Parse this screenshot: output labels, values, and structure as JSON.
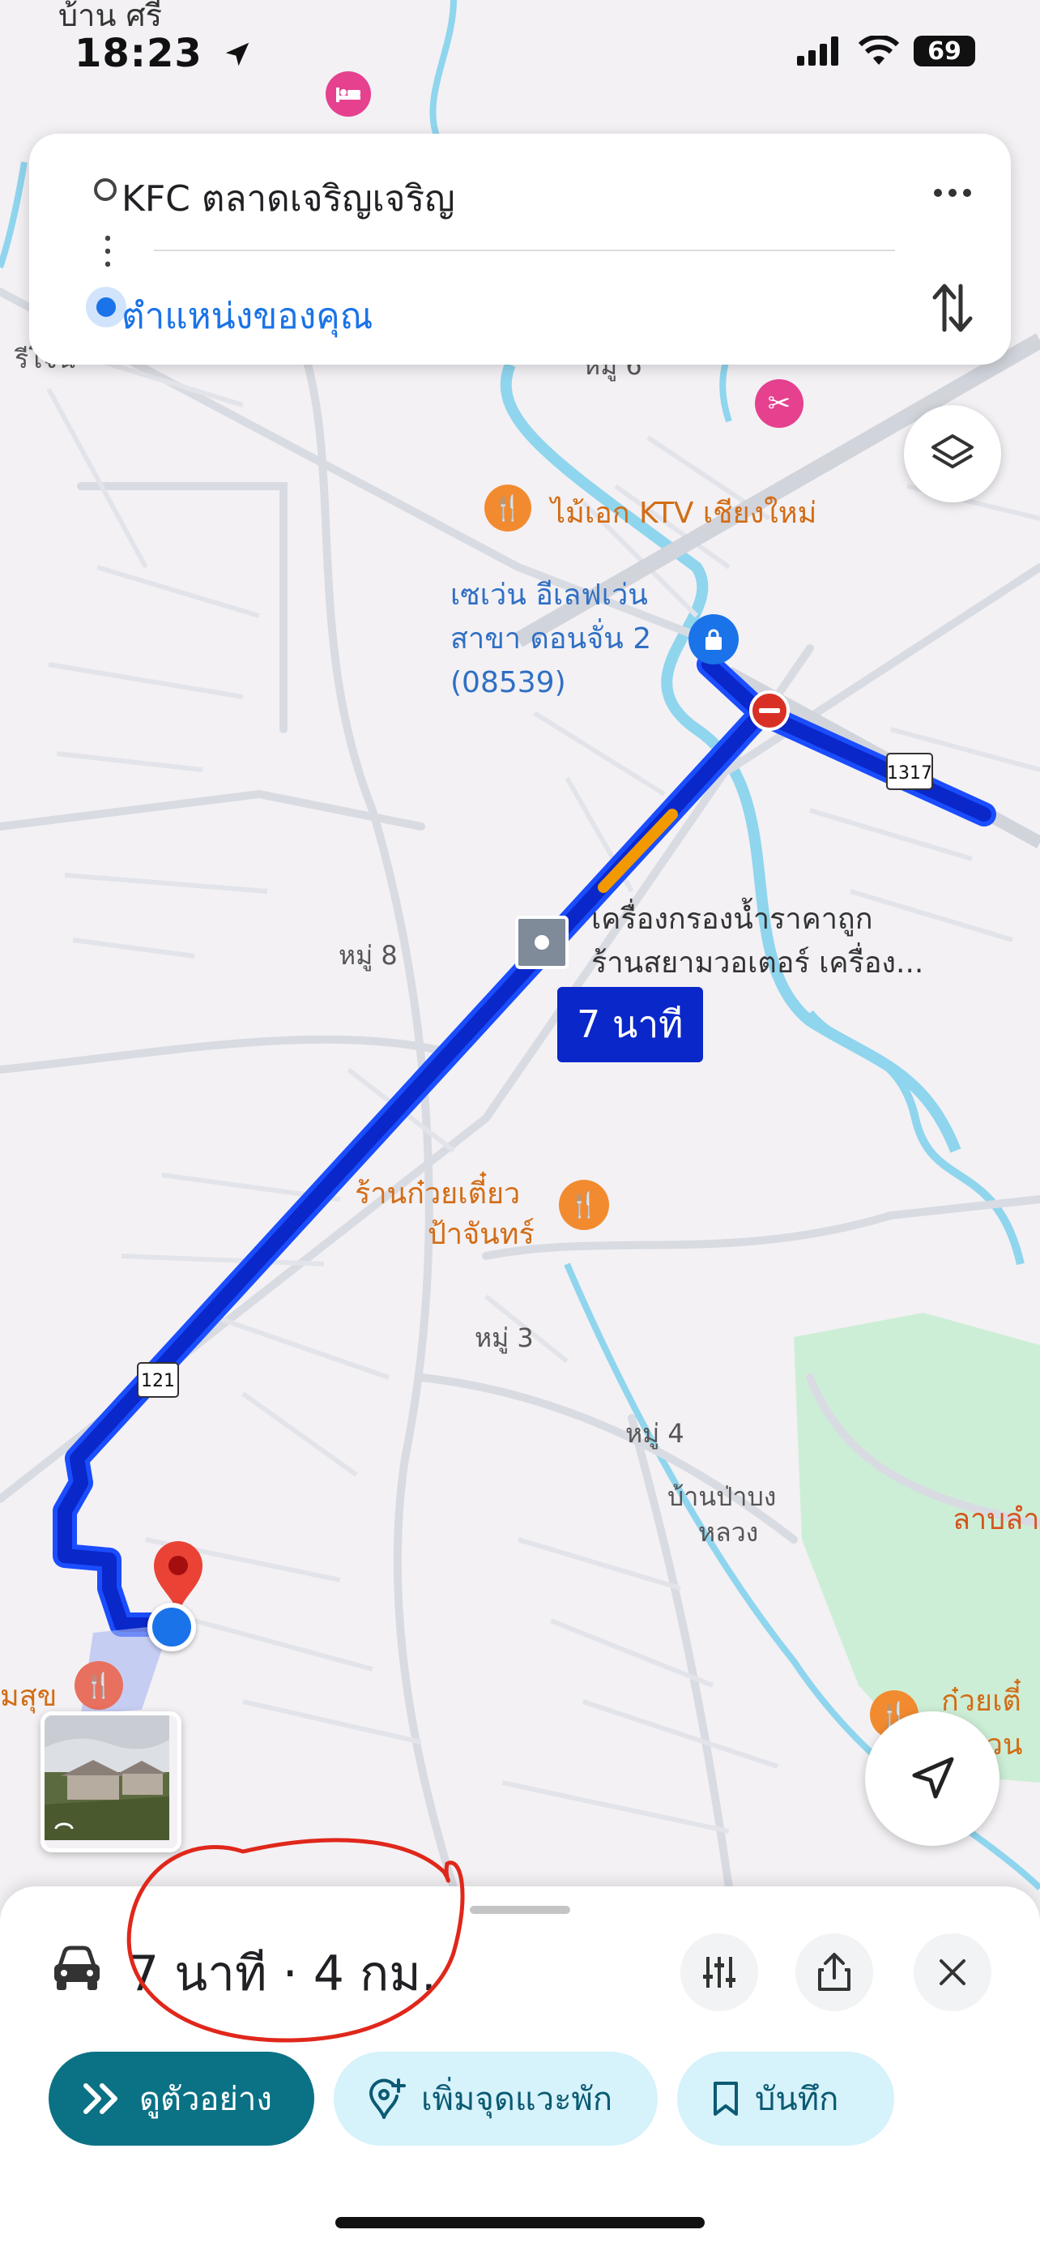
{
  "status_bar": {
    "time": "18:23",
    "battery": "69"
  },
  "route_card": {
    "origin": "KFC ตลาดเจริญเจริญ",
    "destination": "ตำแหน่งของคุณ",
    "more_icon": "more-horizontal-icon",
    "swap_icon": "swap-vertical-icon"
  },
  "map": {
    "labels": {
      "top_village": "บ้าน ศรี",
      "left_cut": "รีโจน์",
      "moo_top": "หมู่ 6",
      "ktv": "ไม้เอก KTV เชียงใหม่",
      "seven_line1": "เซเว่น อีเลฟเว่น",
      "seven_line2": "สาขา ดอนจั่น 2",
      "seven_line3": "(08539)",
      "water_line1": "เครื่องกรองน้ำราคาถูก",
      "water_line2": "ร้านสยามวอเตอร์ เครื่อง...",
      "moo8": "หมู่ 8",
      "noodle_line1": "ร้านก๋วยเตี๋ยว",
      "noodle_line2": "ป้าจันทร์",
      "moo3": "หมู่ 3",
      "moo4": "หมู่ 4",
      "banpa_line1": "บ้านป่าบง",
      "banpa_line2": "หลวง",
      "lab_right": "ลาบลำ",
      "noodle_right1": "ก๋วยเตี๋",
      "noodle_right2": "มสวน",
      "left_restaurant": "มสุข",
      "road_1317": "1317",
      "road_121": "121"
    },
    "duration_badge": "7 นาที"
  },
  "bottom_sheet": {
    "summary": "7 นาที · 4 กม.",
    "preview_button": "ดูตัวอย่าง",
    "add_stop_button": "เพิ่มจุดแวะพัก",
    "save_button": "บันทึก"
  },
  "colors": {
    "route": "#0a27c9",
    "route_edge": "#1a4dff",
    "traffic_slow": "#f29900",
    "primary_chip": "#0b7285",
    "annotation": "#e0271b"
  }
}
